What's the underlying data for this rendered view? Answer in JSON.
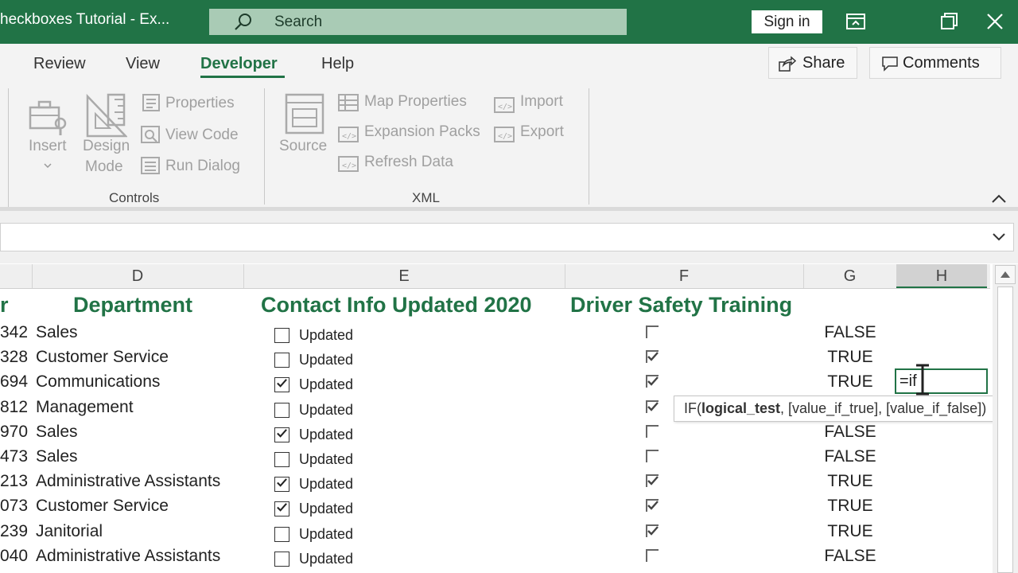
{
  "window": {
    "title": "heckboxes Tutorial  -  Ex...",
    "search_label": "Search",
    "signin_label": "Sign in"
  },
  "tabs": [
    {
      "label": "Review"
    },
    {
      "label": "View"
    },
    {
      "label": "Developer",
      "active": true
    },
    {
      "label": "Help"
    }
  ],
  "actions": {
    "share_label": "Share",
    "comments_label": "Comments"
  },
  "ribbon": {
    "controls": {
      "insert_label": "Insert",
      "design_label_1": "Design",
      "design_label_2": "Mode",
      "properties_label": "Properties",
      "view_code_label": "View Code",
      "run_dialog_label": "Run Dialog",
      "group_label": "Controls"
    },
    "xml": {
      "source_label": "Source",
      "map_properties_label": "Map Properties",
      "expansion_packs_label": "Expansion Packs",
      "refresh_data_label": "Refresh Data",
      "import_label": "Import",
      "export_label": "Export",
      "group_label": "XML"
    }
  },
  "columns": [
    "D",
    "E",
    "F",
    "G",
    "H"
  ],
  "sheet": {
    "header_partial": "r",
    "header_department": "Department",
    "header_contact": "Contact Info Updated 2020",
    "header_driver": "Driver Safety Training",
    "checkbox_label": "Updated",
    "rows": [
      {
        "num": "342",
        "dept": "Sales",
        "contact_checked": false,
        "driver_checked": false,
        "result": "FALSE"
      },
      {
        "num": "328",
        "dept": "Customer Service",
        "contact_checked": false,
        "driver_checked": true,
        "result": "TRUE"
      },
      {
        "num": "694",
        "dept": "Communications",
        "contact_checked": true,
        "driver_checked": true,
        "result": "TRUE"
      },
      {
        "num": "812",
        "dept": "Management",
        "contact_checked": false,
        "driver_checked": true,
        "result": ""
      },
      {
        "num": "970",
        "dept": "Sales",
        "contact_checked": true,
        "driver_checked": false,
        "result": "FALSE"
      },
      {
        "num": "473",
        "dept": "Sales",
        "contact_checked": false,
        "driver_checked": false,
        "result": "FALSE"
      },
      {
        "num": "213",
        "dept": "Administrative Assistants",
        "contact_checked": true,
        "driver_checked": true,
        "result": "TRUE"
      },
      {
        "num": "073",
        "dept": "Customer Service",
        "contact_checked": true,
        "driver_checked": true,
        "result": "TRUE"
      },
      {
        "num": "239",
        "dept": "Janitorial",
        "contact_checked": false,
        "driver_checked": true,
        "result": "TRUE"
      },
      {
        "num": "040",
        "dept": "Administrative Assistants",
        "contact_checked": false,
        "driver_checked": false,
        "result": "FALSE"
      }
    ],
    "active_cell_text": "=if"
  },
  "tooltip": {
    "func": "IF(",
    "arg1": "logical_test",
    "rest": ", [value_if_true], [value_if_false])"
  },
  "colors": {
    "brand": "#217346",
    "ribbon_bg": "#f3f3f3"
  }
}
